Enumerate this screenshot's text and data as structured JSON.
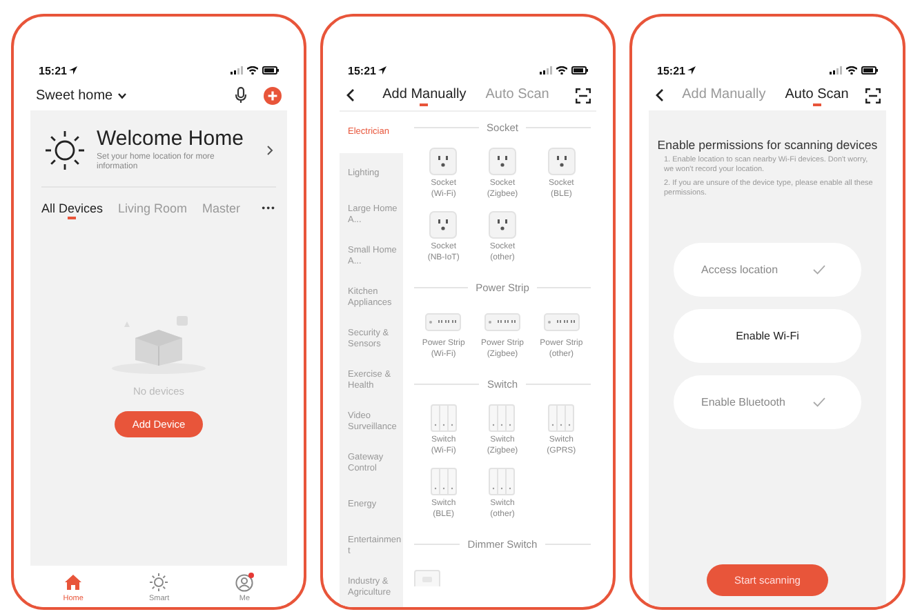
{
  "home_screen": {
    "status_time": "15:21",
    "home_name": "Sweet home",
    "welcome": {
      "title": "Welcome Home",
      "subtitle": "Set your home location for more information"
    },
    "tabs": [
      {
        "label": "All Devices",
        "selected": true
      },
      {
        "label": "Living Room",
        "selected": false
      },
      {
        "label": "Master",
        "selected": false
      }
    ],
    "more": "•••",
    "empty_text": "No devices",
    "add_button": "Add Device",
    "nav": [
      {
        "kind": "home",
        "label": "Home",
        "selected": true,
        "badge": false
      },
      {
        "kind": "smart",
        "label": "Smart",
        "selected": false,
        "badge": false
      },
      {
        "kind": "me",
        "label": "Me",
        "selected": false,
        "badge": true
      }
    ]
  },
  "add_manually_screen": {
    "status_time": "15:21",
    "tabs": [
      {
        "label": "Add Manually",
        "selected": true
      },
      {
        "label": "Auto Scan",
        "selected": false
      }
    ],
    "categories": [
      {
        "label": "Electrician",
        "selected": true
      },
      {
        "label": "Lighting",
        "selected": false
      },
      {
        "label": "Large Home A...",
        "selected": false
      },
      {
        "label": "Small Home A...",
        "selected": false
      },
      {
        "label": "Kitchen Appliances",
        "selected": false
      },
      {
        "label": "Security & Sensors",
        "selected": false
      },
      {
        "label": "Exercise & Health",
        "selected": false
      },
      {
        "label": "Video Surveillance",
        "selected": false
      },
      {
        "label": "Gateway Control",
        "selected": false
      },
      {
        "label": "Energy",
        "selected": false
      },
      {
        "label": "Entertainment",
        "selected": false
      },
      {
        "label": "Industry & Agriculture",
        "selected": false
      }
    ],
    "sections": [
      {
        "title": "Socket",
        "kind": "socket",
        "devices": [
          "Socket\n(Wi-Fi)",
          "Socket\n(Zigbee)",
          "Socket\n(BLE)",
          "Socket\n(NB-IoT)",
          "Socket\n(other)"
        ]
      },
      {
        "title": "Power Strip",
        "kind": "strip",
        "devices": [
          "Power Strip\n(Wi-Fi)",
          "Power Strip\n(Zigbee)",
          "Power Strip\n(other)"
        ]
      },
      {
        "title": "Switch",
        "kind": "switch",
        "devices": [
          "Switch\n(Wi-Fi)",
          "Switch\n(Zigbee)",
          "Switch\n(GPRS)",
          "Switch\n(BLE)",
          "Switch\n(other)"
        ]
      },
      {
        "title": "Dimmer Switch",
        "kind": "dimmer"
      }
    ]
  },
  "auto_scan_screen": {
    "status_time": "15:21",
    "tabs": [
      {
        "label": "Add Manually",
        "selected": false
      },
      {
        "label": "Auto Scan",
        "selected": true
      }
    ],
    "title": "Enable permissions for scanning devices",
    "notes": [
      "1. Enable location to scan nearby Wi-Fi devices. Don't worry, we won't record your location.",
      "2. If you are unsure of the device type, please enable all these permissions."
    ],
    "permissions": [
      {
        "label": "Access location",
        "granted": true
      },
      {
        "label": "Enable Wi-Fi",
        "granted": false
      },
      {
        "label": "Enable Bluetooth",
        "granted": true
      }
    ],
    "start_button": "Start scanning"
  }
}
